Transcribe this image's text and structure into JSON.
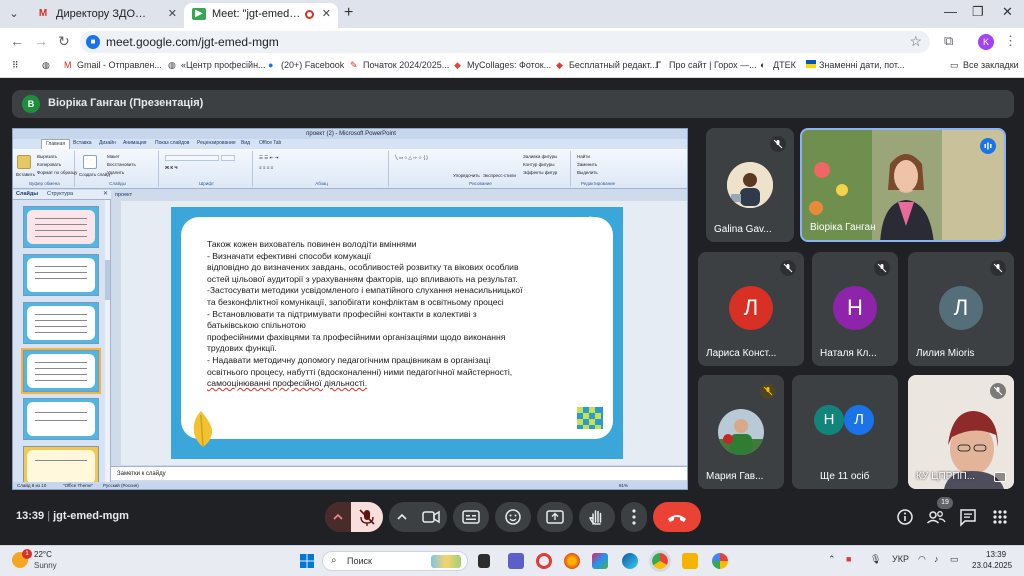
{
  "browser": {
    "tabs": [
      {
        "label": "Директору ЗДО. Запрошення",
        "active": false
      },
      {
        "label": "Meet: \"jgt-emed-mgm\"",
        "active": true
      }
    ],
    "url": "meet.google.com/jgt-emed-mgm",
    "profile_initial": "K",
    "bookmarks": [
      {
        "label": "Gmail - Отправлен..."
      },
      {
        "label": "«Центр професійн..."
      },
      {
        "label": "(20+) Facebook"
      },
      {
        "label": "Початок 2024/2025..."
      },
      {
        "label": "MyCollages: Фоток..."
      },
      {
        "label": "Бесплатный редакт..."
      },
      {
        "label": "Про сайт | Горох —..."
      },
      {
        "label": "ДТЕК"
      },
      {
        "label": "Знаменні дати, пот..."
      }
    ],
    "all_bookmarks": "Все закладки"
  },
  "meet": {
    "presenter_initial": "В",
    "presentation_title": "Віоріка Ганган (Презентація)",
    "meeting_time": "13:39",
    "meeting_code": "jgt-emed-mgm",
    "people_count": "19",
    "participants": [
      {
        "name": "Galina Gav...",
        "muted": true
      },
      {
        "name": "Віоріка Ганган",
        "muted": false
      },
      {
        "name": "Лариса Конст...",
        "initial": "Л",
        "color": "#d93025",
        "muted": true
      },
      {
        "name": "Наталя Кл...",
        "initial": "Н",
        "color": "#8e24aa",
        "muted": true
      },
      {
        "name": "Лилия Miorіs",
        "initial": "Л",
        "color": "#546e7a",
        "muted": true
      },
      {
        "name": "Мария Гав...",
        "muted": true
      },
      {
        "name": "Ще 11 осіб",
        "initials": [
          "Н",
          "Л"
        ]
      },
      {
        "name": "КУ ЦПРПП...",
        "muted": true
      }
    ]
  },
  "ppt": {
    "window_title": "проект (2) - Microsoft PowerPoint",
    "ribbon_tabs": [
      "Главная",
      "Вставка",
      "Дизайн",
      "Анимация",
      "Показ слайдов",
      "Рецензирование",
      "Вид",
      "Office Tab"
    ],
    "ribbon": {
      "cut": "Вырезать",
      "copy": "Копировать",
      "format_painter": "Формат по образцу",
      "paste": "Вставить",
      "new_slide": "Создать слайд",
      "layout": "Макет",
      "reset": "Восстановить",
      "delete": "Удалить",
      "groups": [
        "Буфер обмена",
        "Слайды",
        "Шрифт",
        "Абзац",
        "Рисование",
        "Редактирование"
      ],
      "arrange": "Упорядочить",
      "quick_styles": "Экспресс-стили",
      "fill": "Заливка фигуры",
      "outline": "Контур фигуры",
      "effects": "Эффекты фигур",
      "find": "Найти",
      "replace": "Заменить",
      "select": "Выделить"
    },
    "panel_tabs": [
      "Слайды",
      "Структура"
    ],
    "doc_tab": "проект",
    "doc_tab_active": "проект (2)",
    "notes_placeholder": "Заметки к слайду",
    "status": {
      "slide": "Слайд 8 из 10",
      "theme": "\"Office Theme\"",
      "lang": "Русский (Россия)",
      "zoom": "81%"
    },
    "slide_lines": [
      " Також кожен вихователь повинен володіти вміннями",
      "- Визначати ефективні   способи комукації",
      "відповідно  до визначених      завдань, особливостей розвитку та вікових особлив",
      "остей цільової аудиторії з урахуванням факторів, що впливають на результат.",
      "-Застосувати методики  усвідомленого  і емпатійного  слухання ненасильницької",
      "та безконфліктної комунікації, запобігати конфліктам в освітньому процесі",
      "  - Встановлювати     та підтримувати професійні контакти в колективі з",
      "батьківською спільнотою",
      "професійними фахівцями   та професійними організаціями  щодо виконання",
      "   трудових функції.",
      "- Надавати методичну допомогу педагогічним  працівникам      в організаці",
      "освітнього  процесу, набутті (вдосконаленні)  ними    педагогічної майстерності,",
      "самооцінюванні професійної діяльності."
    ]
  },
  "taskbar": {
    "temperature": "22°C",
    "weather": "Sunny",
    "weather_badge": "1",
    "search_label": "Поиск",
    "language": "УКР",
    "time": "13:39",
    "date": "23.04.2025"
  }
}
